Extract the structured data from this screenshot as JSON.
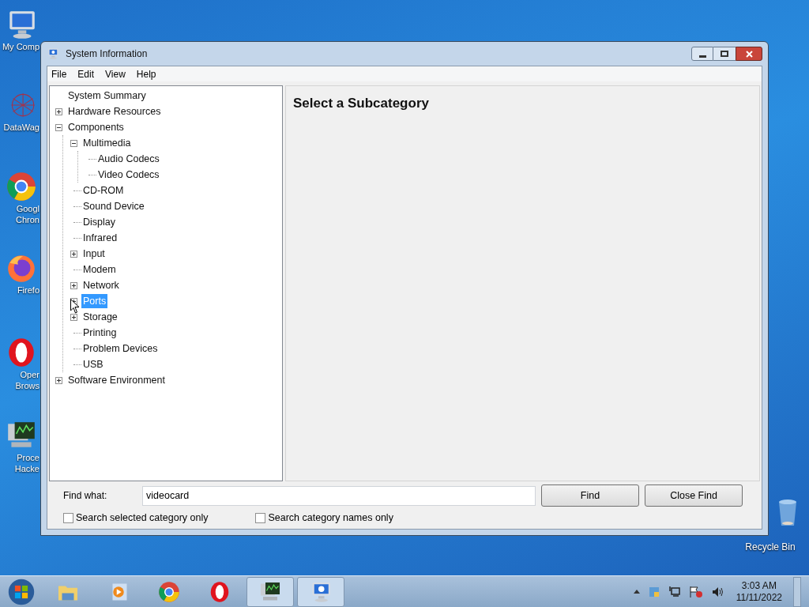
{
  "desktop_icons": [
    {
      "kind": "computer",
      "lines": [
        "My Comp"
      ]
    },
    {
      "kind": "datawag",
      "lines": [
        "DataWag"
      ]
    },
    {
      "kind": "chrome",
      "lines": [
        "Googl",
        "Chron"
      ]
    },
    {
      "kind": "firefox",
      "lines": [
        "Firefo"
      ]
    },
    {
      "kind": "opera",
      "lines": [
        "Oper",
        "Brows"
      ]
    },
    {
      "kind": "hacker",
      "lines": [
        "Proce",
        "Hacke"
      ]
    },
    {
      "kind": "recycle",
      "lines": [
        "Recycle Bin"
      ]
    }
  ],
  "window": {
    "title": "System Information",
    "menu": [
      "File",
      "Edit",
      "View",
      "Help"
    ],
    "tree": [
      {
        "label": "System Summary",
        "selected": false
      },
      {
        "label": "Hardware Resources",
        "selected": false,
        "expanded": false
      },
      {
        "label": "Components",
        "selected": false,
        "expanded": true,
        "children": [
          {
            "label": "Multimedia",
            "selected": false,
            "expanded": true,
            "children": [
              {
                "label": "Audio Codecs",
                "selected": false
              },
              {
                "label": "Video Codecs",
                "selected": false
              }
            ]
          },
          {
            "label": "CD-ROM",
            "selected": false
          },
          {
            "label": "Sound Device",
            "selected": false
          },
          {
            "label": "Display",
            "selected": false
          },
          {
            "label": "Infrared",
            "selected": false
          },
          {
            "label": "Input",
            "selected": false,
            "expanded": false
          },
          {
            "label": "Modem",
            "selected": false
          },
          {
            "label": "Network",
            "selected": false,
            "expanded": false
          },
          {
            "label": "Ports",
            "selected": true,
            "expanded": false
          },
          {
            "label": "Storage",
            "selected": false,
            "expanded": false
          },
          {
            "label": "Printing",
            "selected": false
          },
          {
            "label": "Problem Devices",
            "selected": false
          },
          {
            "label": "USB",
            "selected": false
          }
        ]
      },
      {
        "label": "Software Environment",
        "selected": false,
        "expanded": false
      }
    ],
    "detail_heading": "Select a Subcategory",
    "find": {
      "label": "Find what:",
      "value": "videocard",
      "buttons": [
        "Find",
        "Close Find"
      ],
      "options": [
        {
          "label": "Search selected category only",
          "checked": false
        },
        {
          "label": "Search category names only",
          "checked": false
        }
      ]
    }
  },
  "taskbar": {
    "apps": [
      {
        "kind": "start",
        "active": false
      },
      {
        "kind": "explorer",
        "active": false
      },
      {
        "kind": "media",
        "active": false
      },
      {
        "kind": "chrome",
        "active": false
      },
      {
        "kind": "opera",
        "active": false
      },
      {
        "kind": "hacker",
        "active": true
      },
      {
        "kind": "sysinfo",
        "active": true
      }
    ],
    "time": "3:03 AM",
    "date": "11/11/2022"
  }
}
